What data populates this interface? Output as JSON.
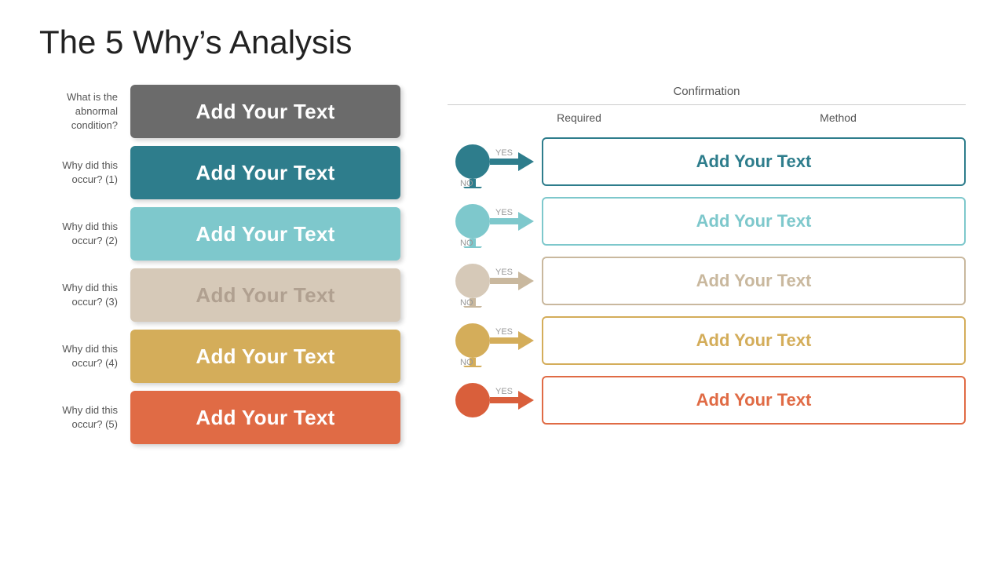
{
  "title": "The 5 Why’s Analysis",
  "left": {
    "rows": [
      {
        "label": "What is the abnormal condition?",
        "text": "Add Your Text",
        "style": "box-gray"
      },
      {
        "label": "Why did this occur? (1)",
        "text": "Add Your Text",
        "style": "box-teal"
      },
      {
        "label": "Why did this occur? (2)",
        "text": "Add Your Text",
        "style": "box-light-teal"
      },
      {
        "label": "Why did this occur? (3)",
        "text": "Add Your Text",
        "style": "box-beige"
      },
      {
        "label": "Why did this occur? (4)",
        "text": "Add Your Text",
        "style": "box-yellow"
      },
      {
        "label": "Why did this occur? (5)",
        "text": "Add Your Text",
        "style": "box-orange"
      }
    ]
  },
  "right": {
    "confirmation_label": "Confirmation",
    "required_label": "Required",
    "method_label": "Method",
    "rows": [
      {
        "text": "Add Your Text",
        "style": "conf-teal",
        "circle_color": "#2e7d8c",
        "arrow_color": "#2e7d8c",
        "yes": "YES",
        "no": "NO"
      },
      {
        "text": "Add Your Text",
        "style": "conf-lt-teal",
        "circle_color": "#7ec8cc",
        "arrow_color": "#7ec8cc",
        "yes": "YES",
        "no": "NO"
      },
      {
        "text": "Add Your Text",
        "style": "conf-beige",
        "circle_color": "#d6c9b8",
        "arrow_color": "#c9b89e",
        "yes": "YES",
        "no": "NO"
      },
      {
        "text": "Add Your Text",
        "style": "conf-yellow",
        "circle_color": "#d4ad5a",
        "arrow_color": "#d4ad5a",
        "yes": "YES",
        "no": "NO"
      },
      {
        "text": "Add Your Text",
        "style": "conf-orange",
        "circle_color": "#d95f3b",
        "arrow_color": "#d95f3b",
        "yes": "YES",
        "no": ""
      }
    ]
  }
}
